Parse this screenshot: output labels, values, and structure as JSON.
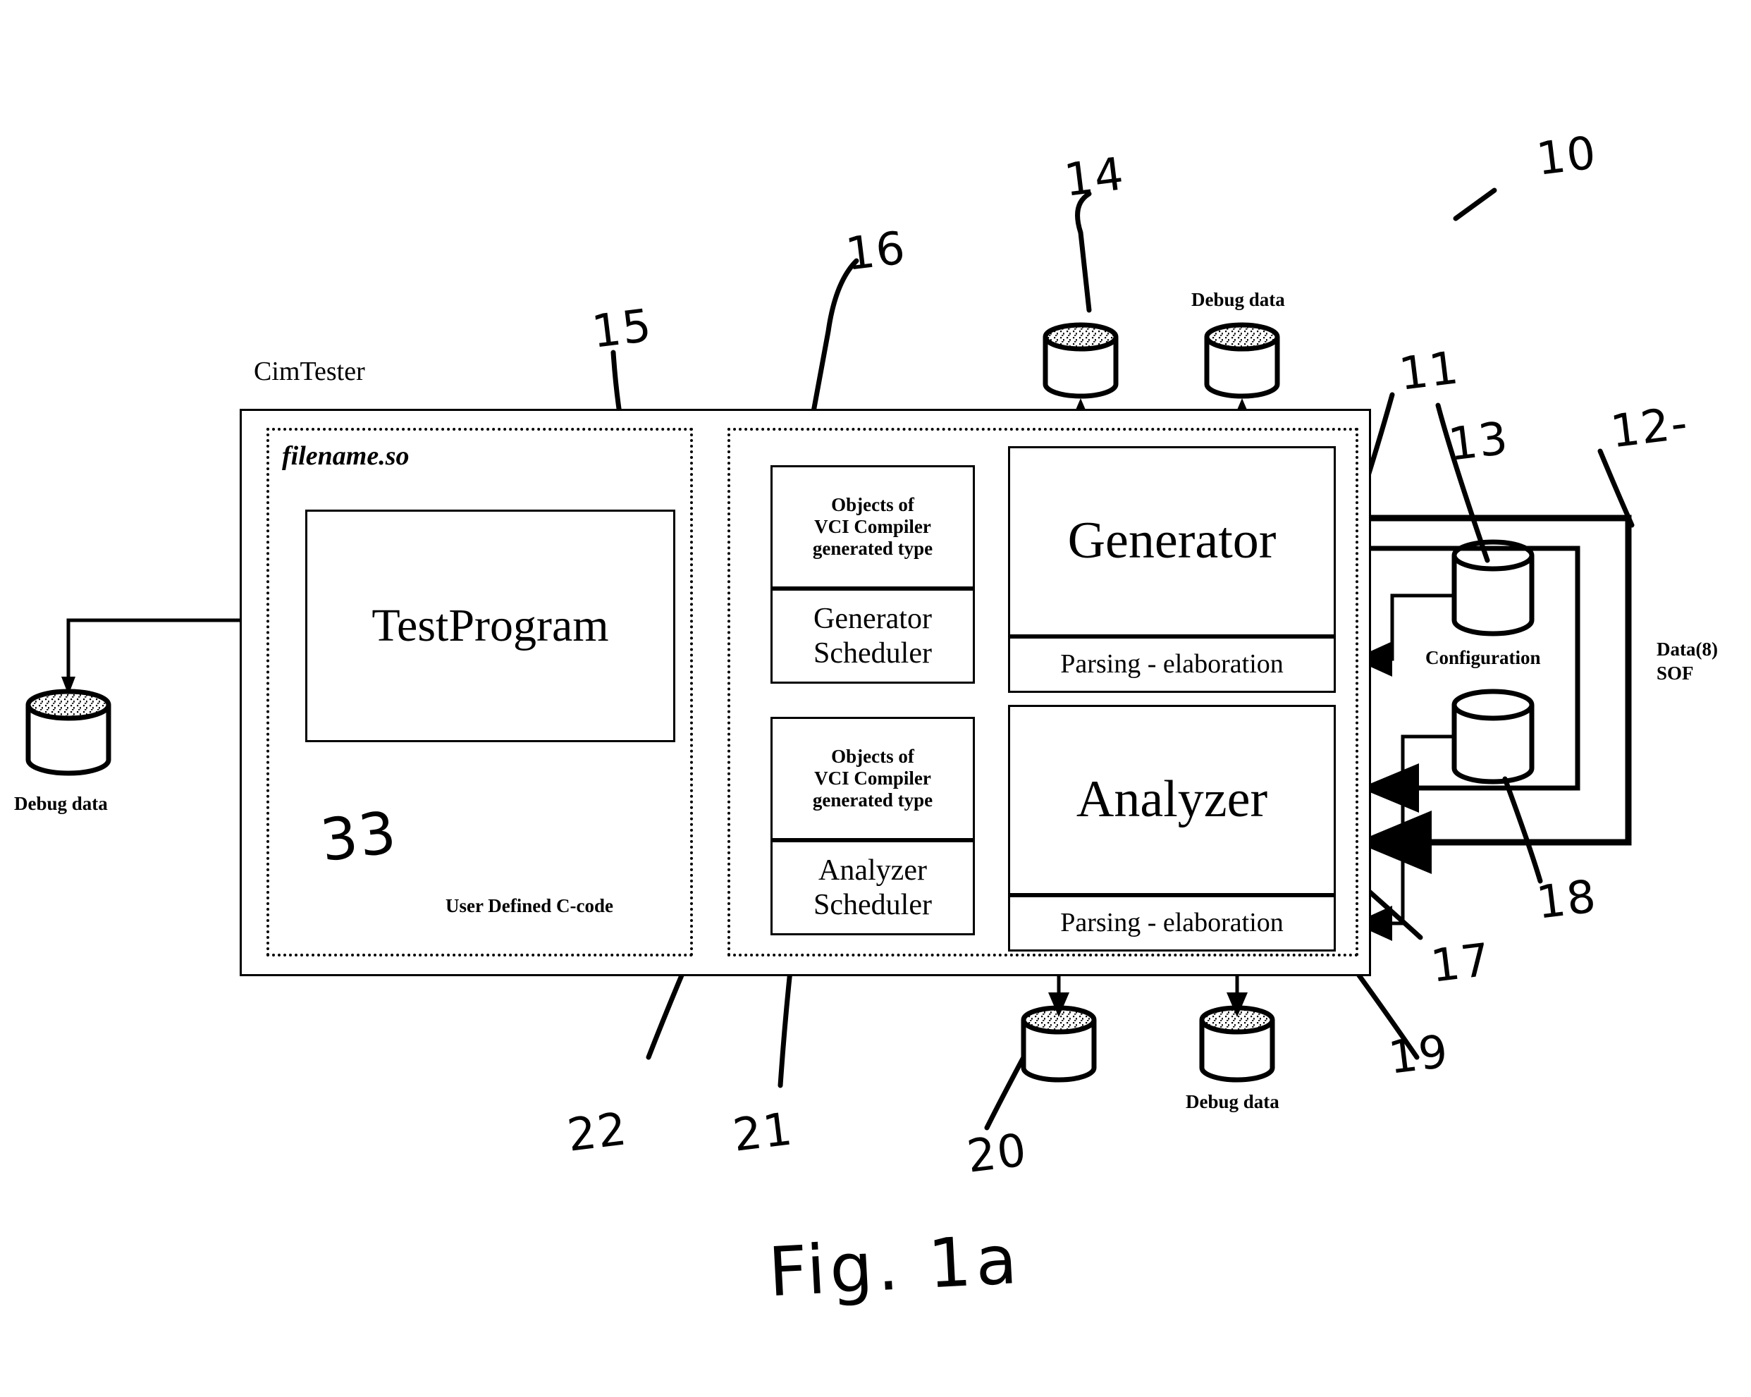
{
  "figure": {
    "caption": "Fig. 1a",
    "system_label": "CimTester",
    "module_file": "filename.so"
  },
  "boxes": {
    "test_program": "TestProgram",
    "user_defined_code": "User Defined C-code",
    "objects_vci_1": "Objects of\nVCI Compiler\ngenerated type",
    "objects_vci_2": "Objects of\nVCI Compiler\ngenerated type",
    "generator_scheduler": "Generator\nScheduler",
    "analyzer_scheduler": "Analyzer\nScheduler",
    "generator": "Generator",
    "analyzer": "Analyzer",
    "parsing_elaboration_1": "Parsing - elaboration",
    "parsing_elaboration_2": "Parsing - elaboration"
  },
  "stores": {
    "debug_data_left": "Debug data",
    "debug_data_top": "Debug data",
    "debug_data_bottom": "Debug data",
    "configuration": "Configuration"
  },
  "signals": {
    "data_sof": "Data(8)\nSOF"
  },
  "reference_numerals": {
    "n10": "10",
    "n11": "11",
    "n12": "12-",
    "n13": "13",
    "n14": "14",
    "n15": "15",
    "n16": "16",
    "n17": "17",
    "n18": "18",
    "n19": "19",
    "n20": "20",
    "n21": "21",
    "n22": "22",
    "n33": "33"
  },
  "colors": {
    "ink": "#000000",
    "paper": "#ffffff"
  }
}
